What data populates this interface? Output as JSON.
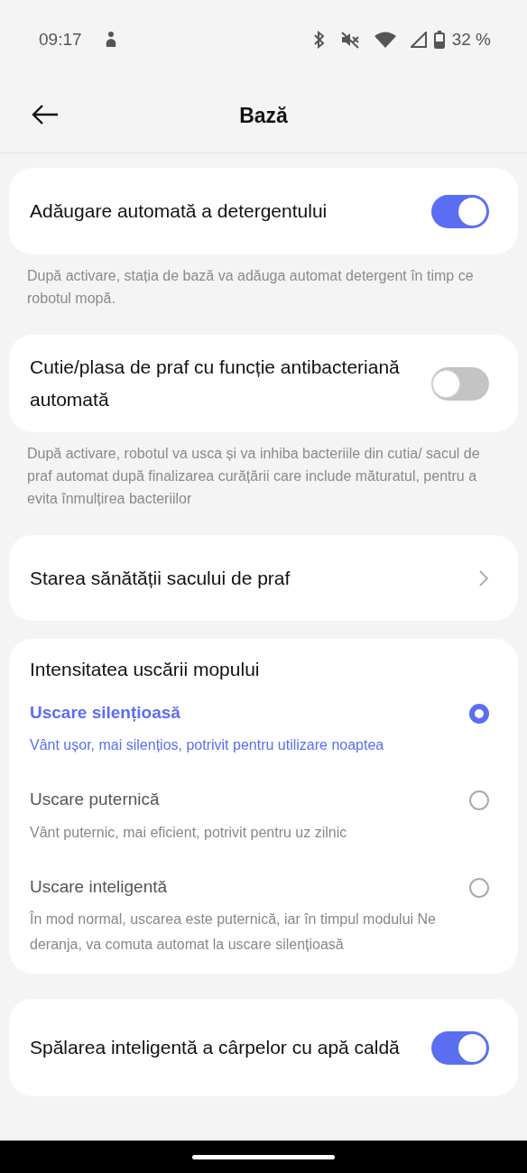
{
  "status_bar": {
    "time": "09:17",
    "battery": "32 %"
  },
  "header": {
    "title": "Bază"
  },
  "sections": [
    {
      "kind": "toggle",
      "label": "Adăugare automată a detergentului",
      "on": true,
      "description": "După activare, stația de bază va adăuga automat detergent în timp ce robotul mopă."
    },
    {
      "kind": "toggle",
      "label": "Cutie/plasa de praf cu funcție antibacteriană automată",
      "on": false,
      "description": "După activare, robotul va usca și va inhiba bacteriile din cutia/ sacul de praf automat după finalizarea curățării care include măturatul, pentru a evita înmulțirea bacteriilor"
    },
    {
      "kind": "link",
      "label": "Starea sănătății sacului de praf"
    },
    {
      "kind": "radio_group",
      "title": "Intensitatea uscării mopului",
      "options": [
        {
          "label": "Uscare silențioasă",
          "description": "Vânt ușor, mai silențios, potrivit pentru utilizare noaptea",
          "selected": true
        },
        {
          "label": "Uscare puternică",
          "description": "Vânt puternic, mai eficient, potrivit pentru uz zilnic",
          "selected": false
        },
        {
          "label": "Uscare inteligentă",
          "description": "În mod normal, uscarea este puternică, iar în timpul modului Ne deranja, va comuta automat la uscare silențioasă",
          "selected": false
        }
      ]
    },
    {
      "kind": "toggle",
      "label": "Spălarea inteligentă a cârpelor cu apă caldă",
      "on": true
    }
  ]
}
